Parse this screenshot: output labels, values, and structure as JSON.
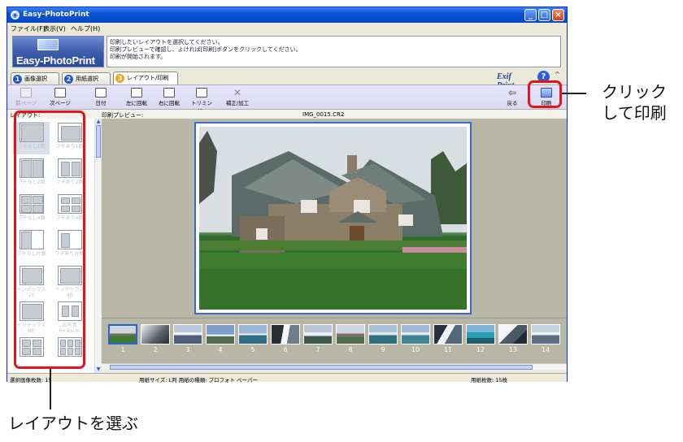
{
  "window": {
    "title": "Easy-PhotoPrint",
    "controls": [
      "_",
      "□",
      "×"
    ]
  },
  "menu": [
    "ファイル(F)",
    "表示(V)",
    "ヘルプ(H)"
  ],
  "banner": {
    "logo_text": "Easy-PhotoPrint",
    "guide_lines": [
      "印刷したいレイアウトを選択してください。",
      "印刷プレビューで確認し、よければ[印刷]ボタンをクリックしてください。",
      "印刷が開始されます。"
    ]
  },
  "tabs": [
    {
      "num": "1",
      "label": "画像選択"
    },
    {
      "num": "2",
      "label": "用紙選択"
    },
    {
      "num": "3",
      "label": "レイアウト/印刷"
    }
  ],
  "exif_logo": "Exif Print",
  "help_label": "?",
  "collapse_label": "^",
  "toolbar": {
    "prev_page": "前ページ",
    "next_page": "次ページ",
    "date": "日付",
    "rotate_left": "左に回転",
    "rotate_right": "右に回転",
    "trimming": "トリミング...",
    "correct": "補正/加工",
    "back": "戻る",
    "print": "印刷"
  },
  "labels": {
    "layout": "レイアウト:",
    "preview": "印刷プレビュー:",
    "filename": "IMG_0015.CR2"
  },
  "layouts": [
    {
      "caption": "フチなし1面"
    },
    {
      "caption": "フチあり1面"
    },
    {
      "caption": "フチなし2面"
    },
    {
      "caption": "フチあり2面"
    },
    {
      "caption": "フチなし4面"
    },
    {
      "caption": "フチあり4面"
    },
    {
      "caption": "フチなし片面"
    },
    {
      "caption": "フチあり片面"
    },
    {
      "caption": "インデックス 20"
    },
    {
      "caption": "インデックス 48"
    },
    {
      "caption": "インデックス 80"
    },
    {
      "caption": "ID写真 6×45cm"
    },
    {
      "caption": ""
    },
    {
      "caption": ""
    }
  ],
  "filmstrip": {
    "numbers": [
      "1",
      "2",
      "3",
      "4",
      "5",
      "6",
      "7",
      "8",
      "9",
      "10",
      "11",
      "12",
      "13",
      "14"
    ],
    "selected_index": 0
  },
  "status": {
    "selected_count": "選択画像枚数: 15",
    "paper_info": "用紙サイズ: L判  用紙の種類: プロフォト ペーパー",
    "sheet_count": "用紙枚数: 15枚"
  },
  "callouts": {
    "click_to_print": "クリック\nして印刷",
    "choose_layout": "レイアウトを選ぶ"
  },
  "colors": {
    "highlight": "#e3141b",
    "titlebar": "#0a52d6",
    "selection": "#3e68c9"
  }
}
